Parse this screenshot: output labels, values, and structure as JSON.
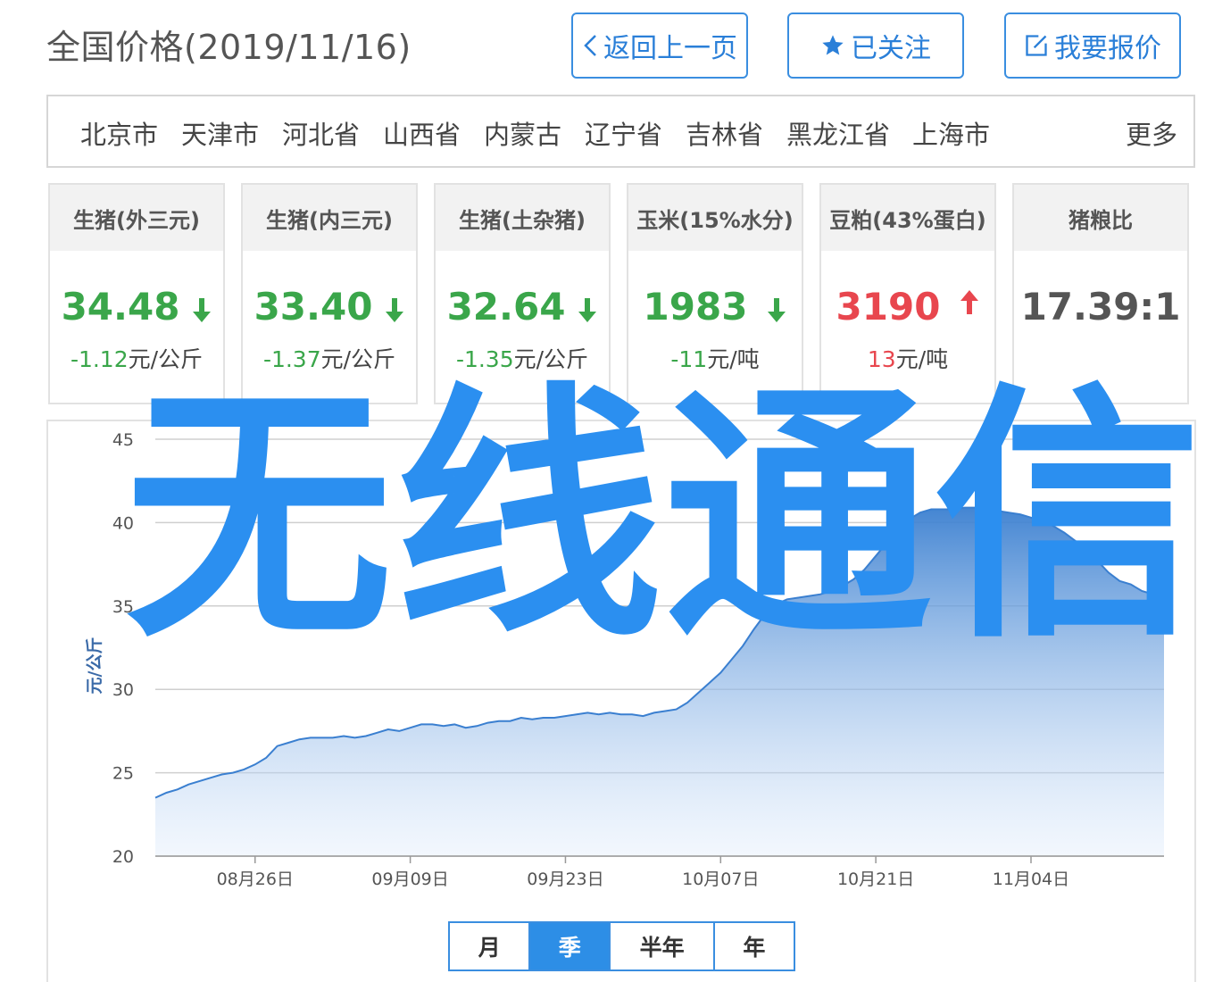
{
  "header": {
    "title": "全国价格(2019/11/16)",
    "back_label": "返回上一页",
    "follow_label": "已关注",
    "quote_label": "我要报价"
  },
  "regions": {
    "items": [
      "北京市",
      "天津市",
      "河北省",
      "山西省",
      "内蒙古",
      "辽宁省",
      "吉林省",
      "黑龙江省",
      "上海市"
    ],
    "more_label": "更多"
  },
  "cards": [
    {
      "title": "生猪(外三元)",
      "value": "34.48",
      "trend": "down",
      "delta": "-1.12",
      "unit": "元/公斤"
    },
    {
      "title": "生猪(内三元)",
      "value": "33.40",
      "trend": "down",
      "delta": "-1.37",
      "unit": "元/公斤"
    },
    {
      "title": "生猪(土杂猪)",
      "value": "32.64",
      "trend": "down",
      "delta": "-1.35",
      "unit": "元/公斤"
    },
    {
      "title": "玉米(15%水分)",
      "value": "1983",
      "trend": "down",
      "delta": "-11",
      "unit": "元/吨"
    },
    {
      "title": "豆粕(43%蛋白)",
      "value": "3190",
      "trend": "up",
      "delta": "13",
      "unit": "元/吨"
    },
    {
      "title": "猪粮比",
      "value": "17.39:1",
      "trend": "none",
      "delta": "",
      "unit": ""
    }
  ],
  "colors": {
    "accent": "#3a8ee0",
    "down": "#3aa64a",
    "up": "#e8464e",
    "line": "#3a7fd0"
  },
  "chart_data": {
    "type": "area",
    "ylabel": "元/公斤",
    "ylim": [
      20,
      45
    ],
    "yticks": [
      20,
      25,
      30,
      35,
      40,
      45
    ],
    "xlim": [
      "2019-08-17",
      "2019-11-16"
    ],
    "xticks": [
      "08月26日",
      "09月09日",
      "09月23日",
      "10月07日",
      "10月21日",
      "11月04日"
    ],
    "xtick_dates": [
      "2019-08-26",
      "2019-09-09",
      "2019-09-23",
      "2019-10-07",
      "2019-10-21",
      "2019-11-04"
    ],
    "series": [
      {
        "x": [
          "2019-08-17",
          "2019-08-18",
          "2019-08-19",
          "2019-08-20",
          "2019-08-21",
          "2019-08-22",
          "2019-08-23",
          "2019-08-24",
          "2019-08-25",
          "2019-08-26",
          "2019-08-27",
          "2019-08-28",
          "2019-08-29",
          "2019-08-30",
          "2019-08-31",
          "2019-09-01",
          "2019-09-02",
          "2019-09-03",
          "2019-09-04",
          "2019-09-05",
          "2019-09-06",
          "2019-09-07",
          "2019-09-08",
          "2019-09-09",
          "2019-09-10",
          "2019-09-11",
          "2019-09-12",
          "2019-09-13",
          "2019-09-14",
          "2019-09-15",
          "2019-09-16",
          "2019-09-17",
          "2019-09-18",
          "2019-09-19",
          "2019-09-20",
          "2019-09-21",
          "2019-09-22",
          "2019-09-23",
          "2019-09-24",
          "2019-09-25",
          "2019-09-26",
          "2019-09-27",
          "2019-09-28",
          "2019-09-29",
          "2019-09-30",
          "2019-10-01",
          "2019-10-02",
          "2019-10-03",
          "2019-10-04",
          "2019-10-05",
          "2019-10-06",
          "2019-10-07",
          "2019-10-08",
          "2019-10-09",
          "2019-10-10",
          "2019-10-11",
          "2019-10-12",
          "2019-10-13",
          "2019-10-14",
          "2019-10-15",
          "2019-10-16",
          "2019-10-17",
          "2019-10-18",
          "2019-10-19",
          "2019-10-20",
          "2019-10-21",
          "2019-10-22",
          "2019-10-23",
          "2019-10-24",
          "2019-10-25",
          "2019-10-26",
          "2019-10-27",
          "2019-10-28",
          "2019-10-29",
          "2019-10-30",
          "2019-10-31",
          "2019-11-01",
          "2019-11-02",
          "2019-11-03",
          "2019-11-04",
          "2019-11-05",
          "2019-11-06",
          "2019-11-07",
          "2019-11-08",
          "2019-11-09",
          "2019-11-10",
          "2019-11-11",
          "2019-11-12",
          "2019-11-13",
          "2019-11-14",
          "2019-11-15",
          "2019-11-16"
        ],
        "values": [
          23.5,
          23.8,
          24.0,
          24.3,
          24.5,
          24.7,
          24.9,
          25.0,
          25.2,
          25.5,
          25.9,
          26.6,
          26.8,
          27.0,
          27.1,
          27.1,
          27.1,
          27.2,
          27.1,
          27.2,
          27.4,
          27.6,
          27.5,
          27.7,
          27.9,
          27.9,
          27.8,
          27.9,
          27.7,
          27.8,
          28.0,
          28.1,
          28.1,
          28.3,
          28.2,
          28.3,
          28.3,
          28.4,
          28.5,
          28.6,
          28.5,
          28.6,
          28.5,
          28.5,
          28.4,
          28.6,
          28.7,
          28.8,
          29.2,
          29.8,
          30.4,
          31.0,
          31.8,
          32.6,
          33.6,
          34.5,
          35.1,
          35.4,
          35.5,
          35.6,
          35.7,
          35.9,
          36.2,
          36.6,
          37.2,
          38.0,
          38.8,
          39.6,
          40.2,
          40.6,
          40.8,
          40.8,
          40.8,
          40.9,
          40.9,
          40.8,
          40.7,
          40.6,
          40.5,
          40.3,
          40.1,
          39.8,
          39.4,
          38.9,
          38.3,
          37.7,
          37.0,
          36.5,
          36.3,
          35.9,
          35.7,
          34.5
        ]
      }
    ]
  },
  "range": {
    "buttons": [
      "月",
      "季",
      "半年",
      "年"
    ],
    "active": "季"
  },
  "watermark": {
    "text": "无线通信"
  }
}
